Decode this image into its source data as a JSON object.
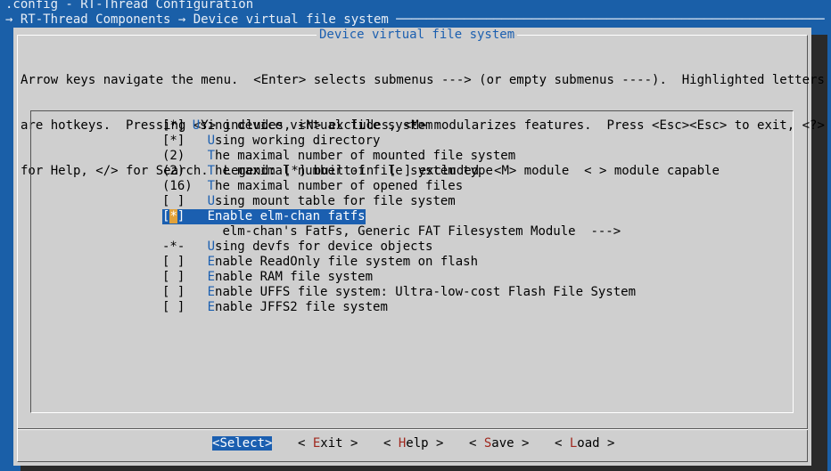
{
  "header": {
    "config_line": ".config - RT-Thread Configuration",
    "breadcrumb": "→ RT-Thread Components → Device virtual file system ─────────────────────────────────────────────────────────"
  },
  "dialog": {
    "title": "Device virtual file system",
    "help_lines": [
      "Arrow keys navigate the menu.  <Enter> selects submenus ---> (or empty submenus ----).  Highlighted letters",
      "are hotkeys.  Pressing <Y> includes, <N> excludes, <M> modularizes features.  Press <Esc><Esc> to exit, <?>",
      "for Help, </> for Search.  Legend: [*] built-in  [ ] excluded  <M> module  < > module capable"
    ]
  },
  "menu": {
    "items": [
      {
        "prefix": "[*] ",
        "hotkey": "U",
        "rest": "sing device virtual file system",
        "selected": false
      },
      {
        "prefix": "[*]   ",
        "hotkey": "U",
        "rest": "sing working directory",
        "selected": false
      },
      {
        "prefix": "(2)   ",
        "hotkey": "T",
        "rest": "he maximal number of mounted file system",
        "selected": false
      },
      {
        "prefix": "(2)   ",
        "hotkey": "T",
        "rest": "he maximal number of file system type",
        "selected": false
      },
      {
        "prefix": "(16)  ",
        "hotkey": "T",
        "rest": "he maximal number of opened files",
        "selected": false
      },
      {
        "prefix": "[ ]   ",
        "hotkey": "U",
        "rest": "sing mount table for file system",
        "selected": false
      },
      {
        "prefix": "[*]   ",
        "hotkey": "E",
        "rest": "nable elm-chan fatfs",
        "selected": true
      },
      {
        "prefix": "        ",
        "hotkey": "",
        "rest": "elm-chan's FatFs, Generic FAT Filesystem Module  --->",
        "selected": false
      },
      {
        "prefix": "-*-   ",
        "hotkey": "U",
        "rest": "sing devfs for device objects",
        "selected": false
      },
      {
        "prefix": "[ ]   ",
        "hotkey": "E",
        "rest": "nable ReadOnly file system on flash",
        "selected": false
      },
      {
        "prefix": "[ ]   ",
        "hotkey": "E",
        "rest": "nable RAM file system",
        "selected": false
      },
      {
        "prefix": "[ ]   ",
        "hotkey": "E",
        "rest": "nable UFFS file system: Ultra-low-cost Flash File System",
        "selected": false
      },
      {
        "prefix": "[ ]   ",
        "hotkey": "E",
        "rest": "nable JFFS2 file system",
        "selected": false
      }
    ]
  },
  "buttons": {
    "select": {
      "pre": "<",
      "hotkey": "S",
      "rest": "elect>"
    },
    "exit": {
      "pre": "< ",
      "hotkey": "E",
      "rest": "xit >"
    },
    "help": {
      "pre": "< ",
      "hotkey": "H",
      "rest": "elp >"
    },
    "save": {
      "pre": "< ",
      "hotkey": "S",
      "rest": "ave >"
    },
    "load": {
      "pre": "< ",
      "hotkey": "L",
      "rest": "oad >"
    }
  },
  "colors": {
    "background": "#1a5fa8",
    "dialog": "#cfcfcf",
    "accent": "#1b5fb0",
    "hotkey_button": "#a0281e",
    "cursor": "#e2a23a"
  }
}
